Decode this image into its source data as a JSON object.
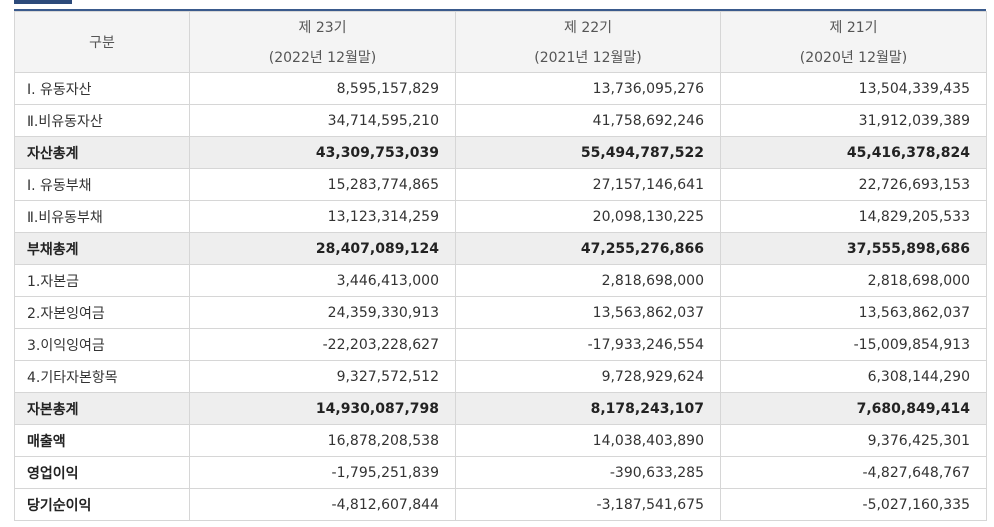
{
  "header": {
    "label": "구분",
    "periods": [
      {
        "title": "제 23기",
        "sub": "(2022년 12월말)"
      },
      {
        "title": "제 22기",
        "sub": "(2021년 12월말)"
      },
      {
        "title": "제 21기",
        "sub": "(2020년 12월말)"
      }
    ]
  },
  "rows": [
    {
      "label": "Ⅰ. 유동자산",
      "values": [
        "8,595,157,829",
        "13,736,095,276",
        "13,504,339,435"
      ]
    },
    {
      "label": "Ⅱ.비유동자산",
      "values": [
        "34,714,595,210",
        "41,758,692,246",
        "31,912,039,389"
      ]
    },
    {
      "label": "자산총계",
      "values": [
        "43,309,753,039",
        "55,494,787,522",
        "45,416,378,824"
      ]
    },
    {
      "label": "Ⅰ. 유동부채",
      "values": [
        "15,283,774,865",
        "27,157,146,641",
        "22,726,693,153"
      ]
    },
    {
      "label": "Ⅱ.비유동부채",
      "values": [
        "13,123,314,259",
        "20,098,130,225",
        "14,829,205,533"
      ]
    },
    {
      "label": "부채총계",
      "values": [
        "28,407,089,124",
        "47,255,276,866",
        "37,555,898,686"
      ]
    },
    {
      "label": "1.자본금",
      "values": [
        "3,446,413,000",
        "2,818,698,000",
        "2,818,698,000"
      ]
    },
    {
      "label": "2.자본잉여금",
      "values": [
        "24,359,330,913",
        "13,563,862,037",
        "13,563,862,037"
      ]
    },
    {
      "label": "3.이익잉여금",
      "values": [
        "-22,203,228,627",
        "-17,933,246,554",
        "-15,009,854,913"
      ]
    },
    {
      "label": "4.기타자본항목",
      "values": [
        "9,327,572,512",
        "9,728,929,624",
        "6,308,144,290"
      ]
    },
    {
      "label": "자본총계",
      "values": [
        "14,930,087,798",
        "8,178,243,107",
        "7,680,849,414"
      ]
    },
    {
      "label": "매출액",
      "values": [
        "16,878,208,538",
        "14,038,403,890",
        "9,376,425,301"
      ]
    },
    {
      "label": "영업이익",
      "values": [
        "-1,795,251,839",
        "-390,633,285",
        "-4,827,648,767"
      ]
    },
    {
      "label": "당기순이익",
      "values": [
        "-4,812,607,844",
        "-3,187,541,675",
        "-5,027,160,335"
      ]
    }
  ]
}
